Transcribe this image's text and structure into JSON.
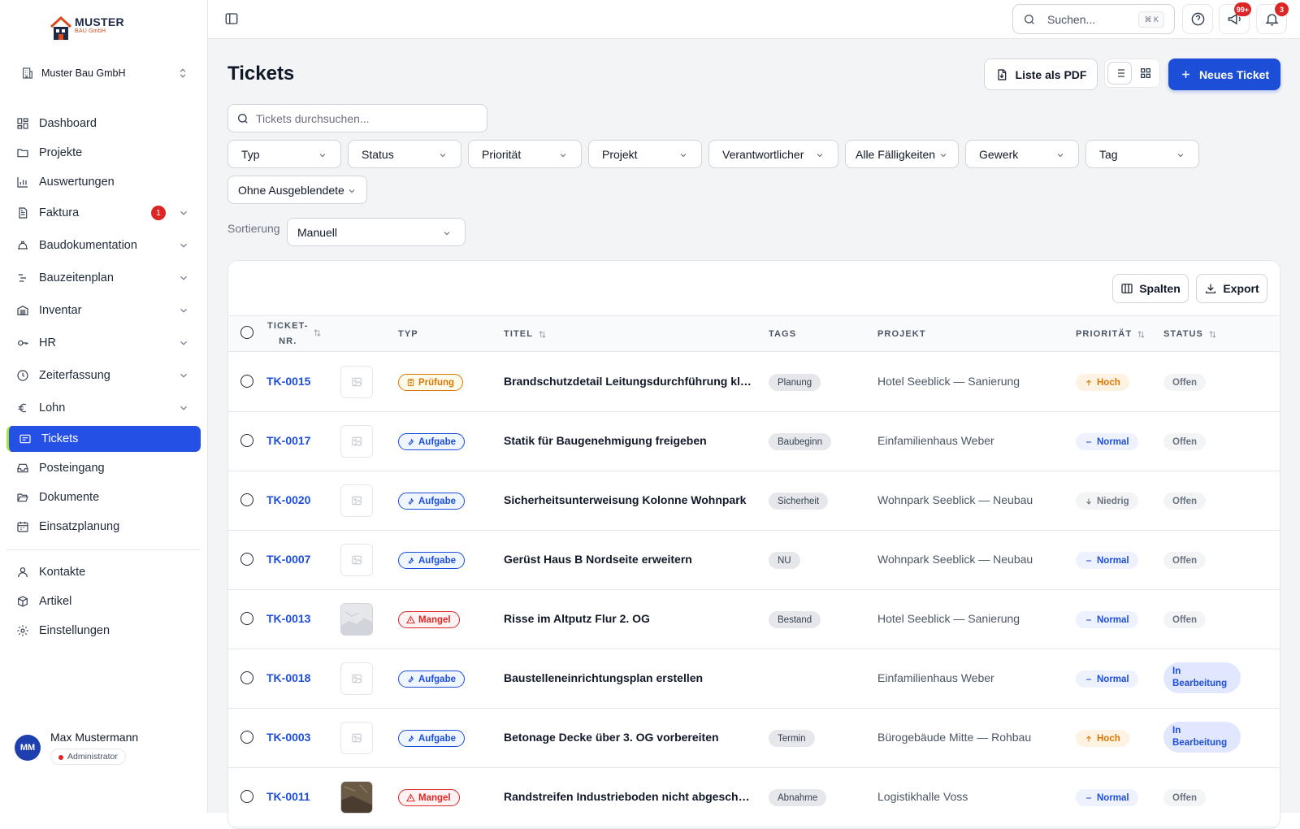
{
  "brand": {
    "name": "MUSTER",
    "sub": "BAU GmbH"
  },
  "company": "Muster Bau GmbH",
  "nav": {
    "dashboard": "Dashboard",
    "projekte": "Projekte",
    "auswertungen": "Auswertungen",
    "faktura": "Faktura",
    "faktura_badge": "1",
    "baudokumentation": "Baudokumentation",
    "bauzeitenplan": "Bauzeitenplan",
    "inventar": "Inventar",
    "hr": "HR",
    "zeiterfassung": "Zeiterfassung",
    "lohn": "Lohn",
    "tickets": "Tickets",
    "posteingang": "Posteingang",
    "dokumente": "Dokumente",
    "einsatzplanung": "Einsatzplanung",
    "kontakte": "Kontakte",
    "artikel": "Artikel",
    "einstellungen": "Einstellungen"
  },
  "user": {
    "initials": "MM",
    "name": "Max Mustermann",
    "role": "Administrator"
  },
  "topbar": {
    "search_placeholder": "Suchen...",
    "shortcut": "⌘ K",
    "messages_badge": "99+",
    "notifications_badge": "3"
  },
  "page": {
    "title": "Tickets",
    "pdf_button": "Liste als PDF",
    "new_button": "Neues Ticket",
    "search_placeholder": "Tickets durchsuchen..."
  },
  "filters": {
    "typ": "Typ",
    "status": "Status",
    "prioritaet": "Priorität",
    "projekt": "Projekt",
    "verantwortlicher": "Verantwortlicher",
    "faelligkeiten": "Alle Fälligkeiten",
    "gewerk": "Gewerk",
    "tag": "Tag",
    "ausgeblendete": "Ohne Ausgeblendete"
  },
  "sort": {
    "label": "Sortierung",
    "value": "Manuell"
  },
  "table": {
    "columns_button": "Spalten",
    "export_button": "Export",
    "headers": {
      "nr_line1": "TICKET-",
      "nr_line2": "NR.",
      "typ": "TYP",
      "titel": "TITEL",
      "tags": "TAGS",
      "projekt": "PROJEKT",
      "prioritaet": "PRIORITÄT",
      "status": "STATUS"
    },
    "rows": [
      {
        "nr": "TK-0015",
        "type": "Prüfung",
        "title": "Brandschutzdetail Leitungsdurchführung klären",
        "tag": "Planung",
        "project": "Hotel Seeblick — Sanierung",
        "priority": "Hoch",
        "status": "Offen"
      },
      {
        "nr": "TK-0017",
        "type": "Aufgabe",
        "title": "Statik für Baugenehmigung freigeben",
        "tag": "Baubeginn",
        "project": "Einfamilienhaus Weber",
        "priority": "Normal",
        "status": "Offen"
      },
      {
        "nr": "TK-0020",
        "type": "Aufgabe",
        "title": "Sicherheitsunterweisung Kolonne Wohnpark",
        "tag": "Sicherheit",
        "project": "Wohnpark Seeblick — Neubau",
        "priority": "Niedrig",
        "status": "Offen"
      },
      {
        "nr": "TK-0007",
        "type": "Aufgabe",
        "title": "Gerüst Haus B Nordseite erweitern",
        "tag": "NU",
        "project": "Wohnpark Seeblick — Neubau",
        "priority": "Normal",
        "status": "Offen"
      },
      {
        "nr": "TK-0013",
        "type": "Mangel",
        "title": "Risse im Altputz Flur 2. OG",
        "tag": "Bestand",
        "project": "Hotel Seeblick — Sanierung",
        "priority": "Normal",
        "status": "Offen"
      },
      {
        "nr": "TK-0018",
        "type": "Aufgabe",
        "title": "Baustelleneinrichtungsplan erstellen",
        "tag": "",
        "project": "Einfamilienhaus Weber",
        "priority": "Normal",
        "status": "In Bearbeitung"
      },
      {
        "nr": "TK-0003",
        "type": "Aufgabe",
        "title": "Betonage Decke über 3. OG vorbereiten",
        "tag": "Termin",
        "project": "Bürogebäude Mitte — Rohbau",
        "priority": "Hoch",
        "status": "In Bearbeitung"
      },
      {
        "nr": "TK-0011",
        "type": "Mangel",
        "title": "Randstreifen Industrieboden nicht abgeschnitten",
        "tag": "Abnahme",
        "project": "Logistikhalle Voss",
        "priority": "Normal",
        "status": "Offen"
      }
    ]
  },
  "colors": {
    "primary": "#1d4ed8",
    "active_nav": "#2450e6",
    "active_accent": "#a3e635",
    "badge_red": "#dc2626"
  }
}
